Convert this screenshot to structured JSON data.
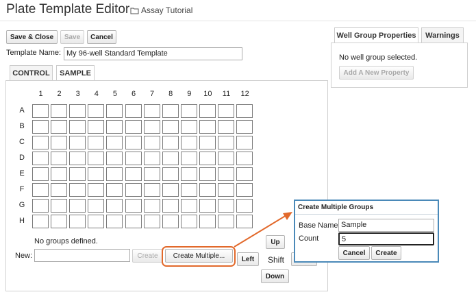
{
  "header": {
    "title": "Plate Template Editor",
    "breadcrumb": "Assay Tutorial"
  },
  "toolbar": {
    "save_close": "Save & Close",
    "save": "Save",
    "cancel": "Cancel"
  },
  "template": {
    "name_label": "Template Name:",
    "name_value": "My 96-well Standard Template"
  },
  "tabs": [
    "CONTROL",
    "SAMPLE"
  ],
  "plate": {
    "columns": [
      "1",
      "2",
      "3",
      "4",
      "5",
      "6",
      "7",
      "8",
      "9",
      "10",
      "11",
      "12"
    ],
    "rows": [
      "A",
      "B",
      "C",
      "D",
      "E",
      "F",
      "G",
      "H"
    ],
    "no_groups": "No groups defined.",
    "new_label": "New:",
    "create": "Create",
    "create_multiple": "Create Multiple...",
    "shift": "Shift",
    "up": "Up",
    "down": "Down",
    "left": "Left"
  },
  "right_panel": {
    "tabs": [
      "Well Group Properties",
      "Warnings"
    ],
    "no_selection": "No well group selected.",
    "add_property": "Add A New Property"
  },
  "dialog": {
    "title": "Create Multiple Groups",
    "base_name_label": "Base Name",
    "base_name_value": "Sample",
    "count_label": "Count",
    "count_value": "5",
    "cancel": "Cancel",
    "create": "Create"
  },
  "colors": {
    "accent_callout": "#e2692b",
    "dialog_border": "#4a89b8"
  }
}
